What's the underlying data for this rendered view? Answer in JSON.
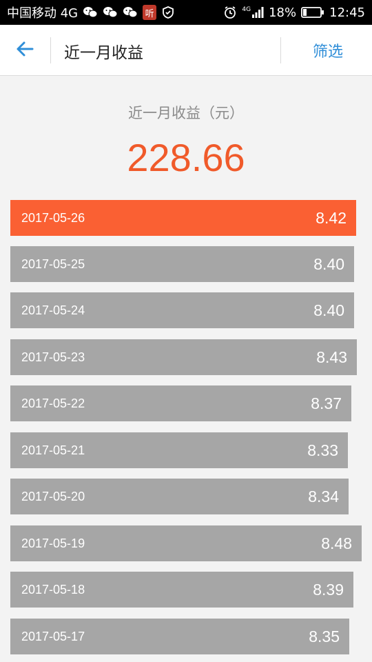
{
  "status_bar": {
    "carrier": "中国移动 4G",
    "listen_badge": "听",
    "network_small": "4G",
    "battery": "18%",
    "time": "12:45"
  },
  "header": {
    "title": "近一月收益",
    "filter_label": "筛选"
  },
  "summary": {
    "label": "近一月收益（元）",
    "amount": "228.66"
  },
  "colors": {
    "accent": "#f05a2a",
    "active_row": "#fa6033",
    "row": "#a6a6a6",
    "link": "#2f8ed8"
  },
  "earnings": [
    {
      "date": "2017-05-26",
      "value": "8.42",
      "active": true
    },
    {
      "date": "2017-05-25",
      "value": "8.40"
    },
    {
      "date": "2017-05-24",
      "value": "8.40"
    },
    {
      "date": "2017-05-23",
      "value": "8.43"
    },
    {
      "date": "2017-05-22",
      "value": "8.37"
    },
    {
      "date": "2017-05-21",
      "value": "8.33"
    },
    {
      "date": "2017-05-20",
      "value": "8.34"
    },
    {
      "date": "2017-05-19",
      "value": "8.48"
    },
    {
      "date": "2017-05-18",
      "value": "8.39"
    },
    {
      "date": "2017-05-17",
      "value": "8.35"
    }
  ]
}
